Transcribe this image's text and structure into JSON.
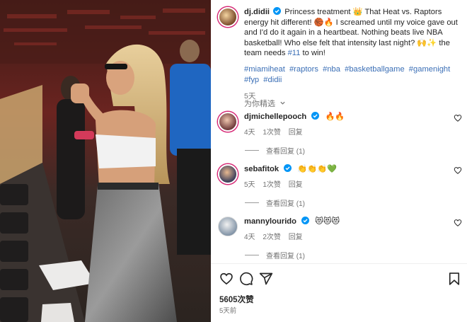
{
  "post": {
    "author": "dj.didii",
    "caption": "Princess treatment 👑 That Heat vs. Raptors energy hit different! 🏀🔥 I screamed until my voice gave out and I'd do it again in a heartbeat. Nothing beats live NBA basketball! Who else felt that intensity last night? 🙌✨ the team needs",
    "caption_tag": "#11",
    "caption_end": "to win!",
    "hashtags": [
      "#miamiheat",
      "#raptors",
      "#nba",
      "#basketballgame",
      "#gamenight",
      "#fyp",
      "#didii"
    ],
    "time": "5天"
  },
  "sort_label": "为你精选",
  "comments": [
    {
      "username": "djmichellepooch",
      "text": "🔥🔥",
      "time": "4天",
      "likes": "1次赞",
      "reply_label": "回复",
      "view_replies": "查看回复 (1)"
    },
    {
      "username": "sebafitok",
      "text": "👏👏👏💚",
      "time": "5天",
      "likes": "1次赞",
      "reply_label": "回复",
      "view_replies": "查看回复 (1)"
    },
    {
      "username": "mannylourido",
      "text": "😻😻😻",
      "time": "4天",
      "likes": "2次赞",
      "reply_label": "回复",
      "view_replies": "查看回复 (1)"
    }
  ],
  "footer": {
    "likes": "5605次赞",
    "time_ago": "5天前"
  },
  "icons": {
    "like": "heart-icon",
    "comment": "comment-icon",
    "share": "share-icon",
    "save": "bookmark-icon",
    "verified": "verified-badge-icon",
    "chevron": "chevron-down-icon"
  },
  "colors": {
    "text": "#262626",
    "muted": "#737373",
    "hashtag": "#3b6fb6",
    "verified": "#0095f6"
  }
}
